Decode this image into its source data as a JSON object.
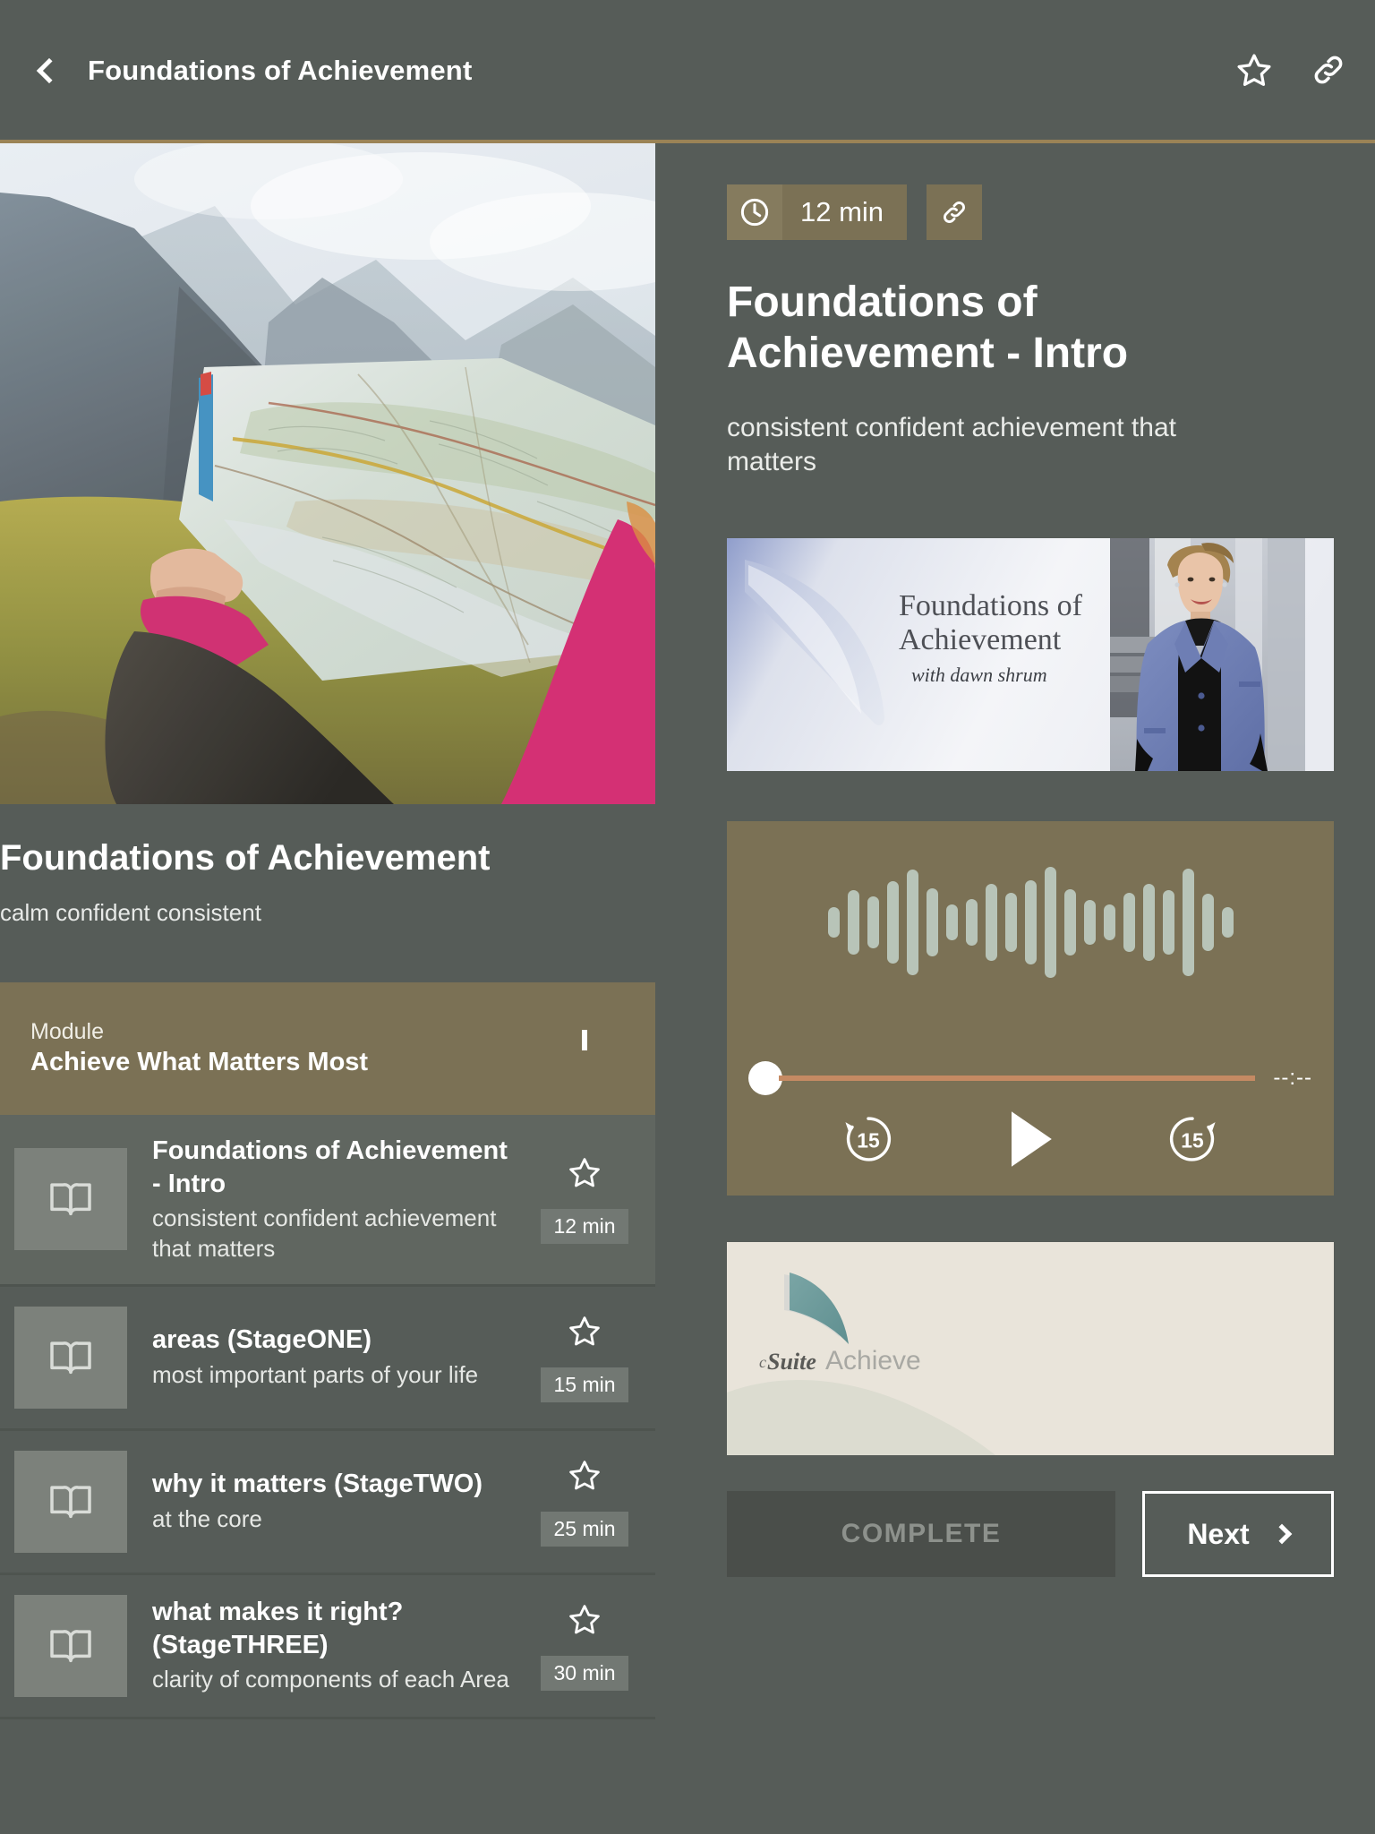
{
  "header": {
    "title": "Foundations of Achievement",
    "back_icon": "chevron-left-icon",
    "favorite_icon": "star-outline-icon",
    "share_icon": "link-icon"
  },
  "colors": {
    "page_bg": "#565c58",
    "accent_olive": "#7b7155",
    "divider_gold": "#9b8356",
    "progress_track": "#c58a63",
    "waveform": "#b8c4b8",
    "active_row": "#606660"
  },
  "course": {
    "hero_alt": "person holding topographic map in mountains",
    "title": "Foundations of Achievement",
    "subtitle": "calm confident consistent"
  },
  "module": {
    "kicker": "Module",
    "name": "Achieve What Matters Most",
    "collapse_icon": "chevron-up-icon",
    "expanded": true
  },
  "lessons": [
    {
      "title": "Foundations of Achievement - Intro",
      "desc": "consistent confident achievement that matters",
      "duration": "12 min",
      "icon": "book-open-icon",
      "favorite_icon": "star-outline-icon",
      "active": true
    },
    {
      "title": "areas (StageONE)",
      "desc": "most important parts of your life",
      "duration": "15 min",
      "icon": "book-open-icon",
      "favorite_icon": "star-outline-icon",
      "active": false
    },
    {
      "title": "why it matters (StageTWO)",
      "desc": "at the core",
      "duration": "25 min",
      "icon": "book-open-icon",
      "favorite_icon": "star-outline-icon",
      "active": false
    },
    {
      "title": "what makes it right? (StageTHREE)",
      "desc": "clarity of components of each Area",
      "duration": "30 min",
      "icon": "book-open-icon",
      "favorite_icon": "star-outline-icon",
      "active": false
    }
  ],
  "detail": {
    "duration": "12 min",
    "clock_icon": "clock-icon",
    "share_icon": "link-icon",
    "title": "Foundations of Achievement - Intro",
    "subtitle": "consistent confident achievement that matters"
  },
  "slide": {
    "title_line1": "Foundations of",
    "title_line2": "Achievement",
    "byline": "with dawn shrum",
    "portrait_alt": "presenter in blue blazer"
  },
  "player": {
    "waveform_icon": "audio-waveform",
    "waveform_heights": [
      34,
      72,
      58,
      92,
      118,
      76,
      40,
      52,
      86,
      66,
      94,
      124,
      74,
      50,
      40,
      66,
      86,
      72,
      120,
      64,
      34
    ],
    "progress_percent": 0,
    "time_display": "--:--",
    "rewind_label": "15",
    "rewind_icon": "rewind-15-icon",
    "play_icon": "play-icon",
    "forward_label": "15",
    "forward_icon": "forward-15-icon"
  },
  "logo_panel": {
    "brand_prefix": "c",
    "brand_bold": "Suite",
    "brand_light": "Achieve",
    "mark_icon": "sail-mark-icon"
  },
  "footer": {
    "complete_label": "COMPLETE",
    "complete_disabled": true,
    "next_label": "Next",
    "next_icon": "chevron-right-icon"
  }
}
